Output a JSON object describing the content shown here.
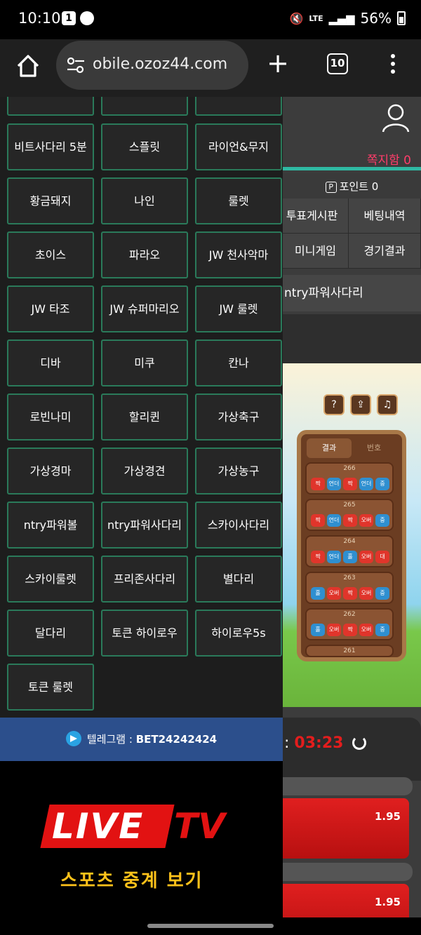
{
  "status_bar": {
    "time": "10:10",
    "notification_count": "1",
    "network": "LTE",
    "battery": "56%"
  },
  "browser": {
    "url": "obile.ozoz44.com",
    "tab_count": "10"
  },
  "right_panel": {
    "message_link": "쪽지함 0",
    "points_label": "포인트 0",
    "points_badge": "P",
    "nav": [
      "투표게시판",
      "베팅내역",
      "미니게임",
      "경기결과"
    ],
    "game_title": "ntry파워사다리",
    "timer_prefix": ":",
    "timer_value": "03:23",
    "odds": [
      "1.95",
      "1.95"
    ]
  },
  "game_board": {
    "tabs": [
      "결과",
      "번호"
    ],
    "rounds": [
      {
        "num": "266",
        "chips": [
          "짝",
          "언더",
          "짝",
          "언더",
          "중"
        ]
      },
      {
        "num": "265",
        "chips": [
          "짝",
          "언더",
          "짝",
          "오버",
          "중"
        ]
      },
      {
        "num": "264",
        "chips": [
          "짝",
          "언더",
          "홀",
          "오버",
          "대"
        ]
      },
      {
        "num": "263",
        "chips": [
          "홀",
          "오버",
          "짝",
          "오버",
          "중"
        ]
      },
      {
        "num": "262",
        "chips": [
          "홀",
          "오버",
          "짝",
          "오버",
          "중"
        ]
      }
    ],
    "next_round": "261"
  },
  "menu": {
    "items": [
      "비트사다리 5분",
      "스플릿",
      "라이언&무지",
      "황금돼지",
      "나인",
      "룰렛",
      "초이스",
      "파라오",
      "JW 천사악마",
      "JW 타조",
      "JW 슈퍼마리오",
      "JW 룰렛",
      "디바",
      "미쿠",
      "칸나",
      "로빈나미",
      "할리퀸",
      "가상축구",
      "가상경마",
      "가상경견",
      "가상농구",
      "ntry파워볼",
      "ntry파워사다리",
      "스카이사다리",
      "스카이룰렛",
      "프리존사다리",
      "별다리",
      "달다리",
      "토큰 하이로우",
      "하이로우5s",
      "토큰 룰렛"
    ]
  },
  "telegram": {
    "label": "텔레그램 : ",
    "handle": "BET24242424"
  },
  "banner": {
    "live": "LIVE",
    "tv": "TV",
    "subtitle": "스포츠 중계 보기"
  },
  "colors": {
    "menu_border": "#2a7a5a",
    "accent_teal": "#2fb9a3",
    "message_pink": "#ff3d6a",
    "timer_red": "#e41d1d",
    "telegram_blue": "#2c4f8c"
  }
}
